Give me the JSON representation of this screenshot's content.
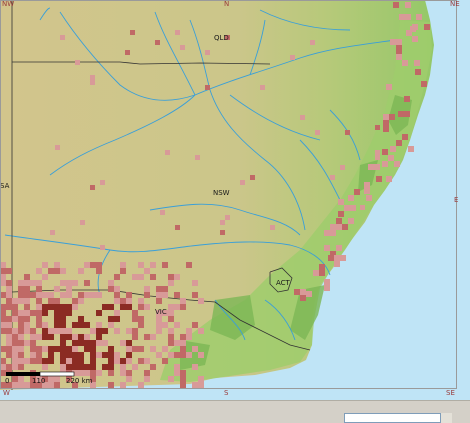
{
  "map": {
    "region_labels": [
      "QLD",
      "NSW",
      "SA",
      "VIC",
      "ACT"
    ],
    "compass": {
      "top": [
        "NW",
        "N",
        "NE"
      ],
      "bottom": [
        "W",
        "S",
        "SE"
      ],
      "right": [
        "E"
      ]
    },
    "scale": {
      "zero": "0",
      "mid": "110",
      "end": "220 km"
    },
    "colors": {
      "ocean": "#bfe4f6",
      "land_dry": "#d4c892",
      "land_green": "#9ccf6a",
      "land_dark_green": "#7ab653",
      "river": "#3a9fd8",
      "border": "#333333",
      "occurrence_light": "#d89a98",
      "occurrence_mid": "#c06966",
      "occurrence_dark": "#8b2b23"
    }
  },
  "footer": {
    "label": "",
    "combo_value": ""
  }
}
